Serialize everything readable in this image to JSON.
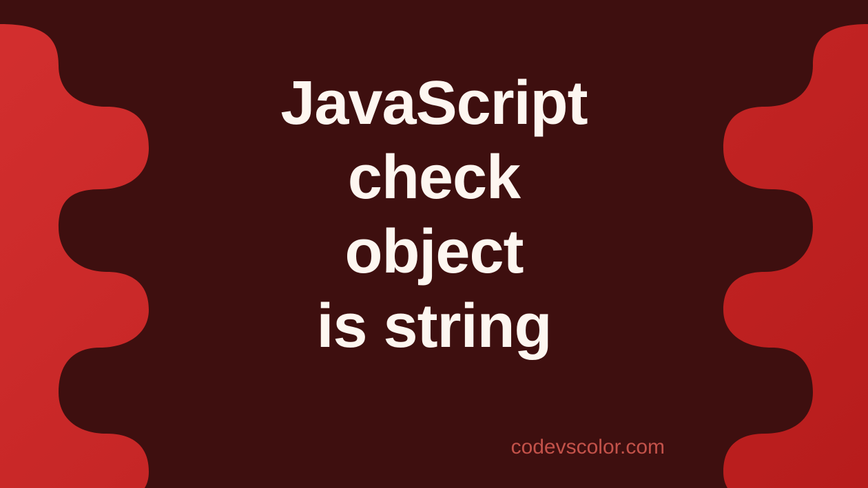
{
  "title": {
    "line1": "JavaScript",
    "line2": "check",
    "line3": "object",
    "line4": "is string"
  },
  "watermark": "codevscolor.com",
  "colors": {
    "bg_gradient_start": "#d32f2f",
    "bg_gradient_end": "#b71c1c",
    "blob": "#3e0f0f",
    "text": "#fdf6f0",
    "watermark": "#c4524a"
  }
}
